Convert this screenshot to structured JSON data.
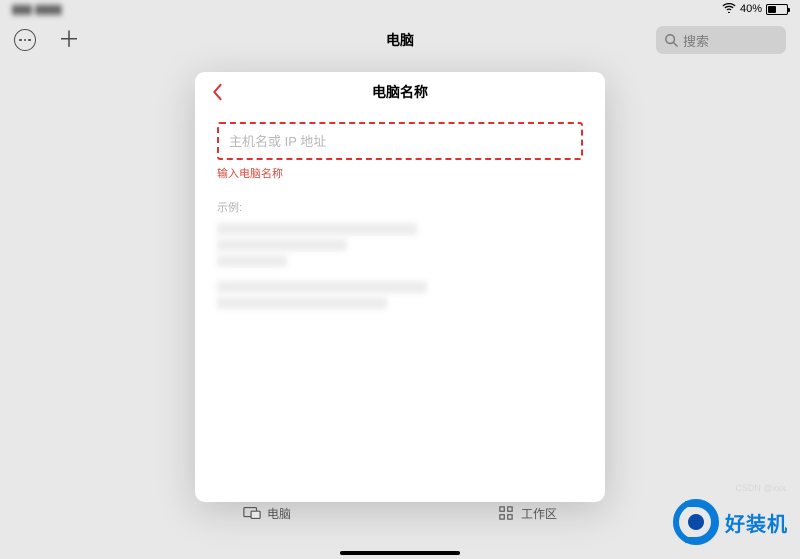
{
  "status": {
    "battery_pct": "40%"
  },
  "toolbar": {
    "title": "电脑",
    "search_placeholder": "搜索"
  },
  "sheet": {
    "title": "电脑名称",
    "input_placeholder": "主机名或 IP 地址",
    "error": "输入电脑名称",
    "example_label": "示例:"
  },
  "tabs": {
    "computer": "电脑",
    "workspace": "工作区"
  },
  "watermark": {
    "text": "好装机",
    "csdn": "CSDN @xxx"
  }
}
